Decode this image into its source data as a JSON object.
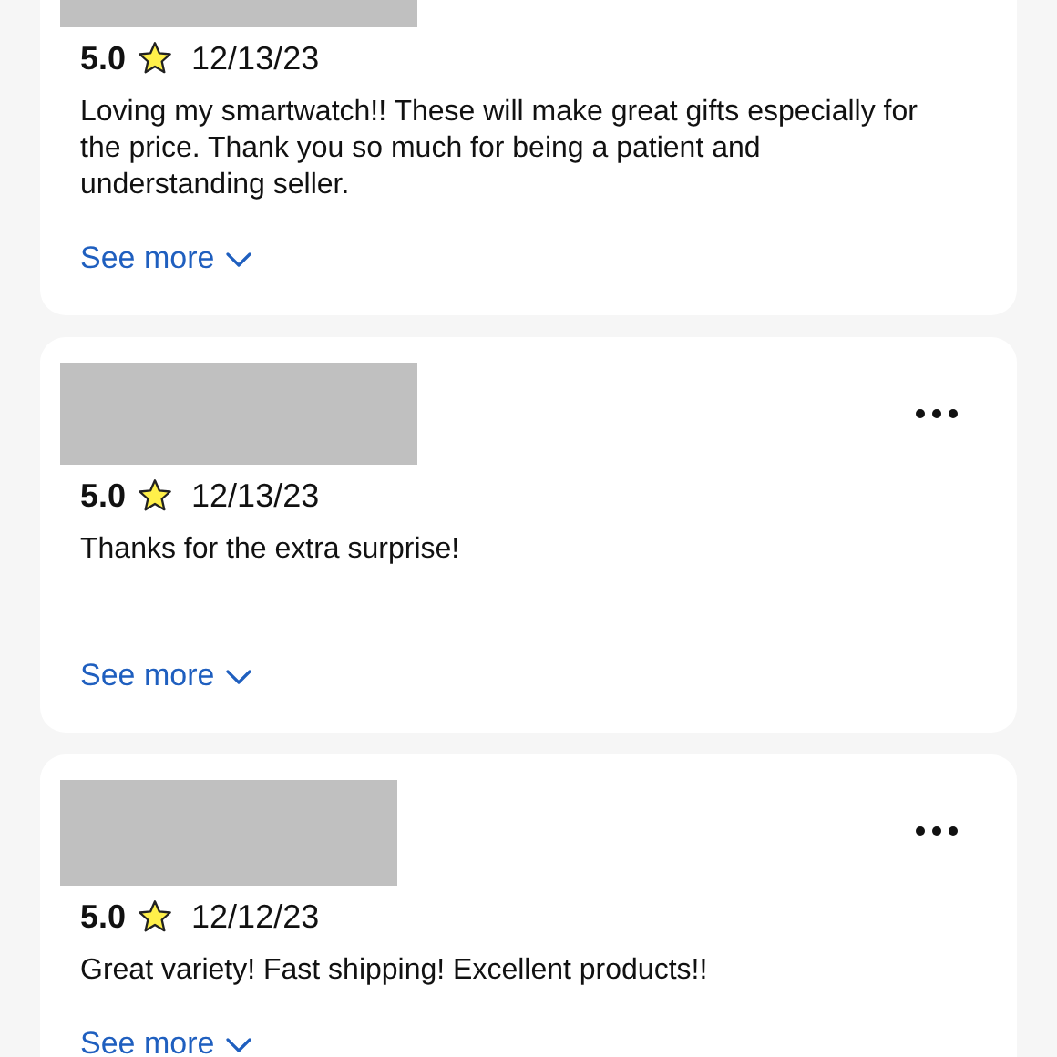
{
  "reviews": [
    {
      "rating": "5.0",
      "date": "12/13/23",
      "text": "Loving my smartwatch!! These will make great gifts especially for the price. Thank you so much for being a patient and understanding seller.",
      "link": "See more"
    },
    {
      "rating": "5.0",
      "date": "12/13/23",
      "text": "Thanks for the extra surprise!",
      "link": "See more"
    },
    {
      "rating": "5.0",
      "date": "12/12/23",
      "text": "Great variety! Fast shipping! Excellent products!!",
      "link": "See more"
    }
  ]
}
